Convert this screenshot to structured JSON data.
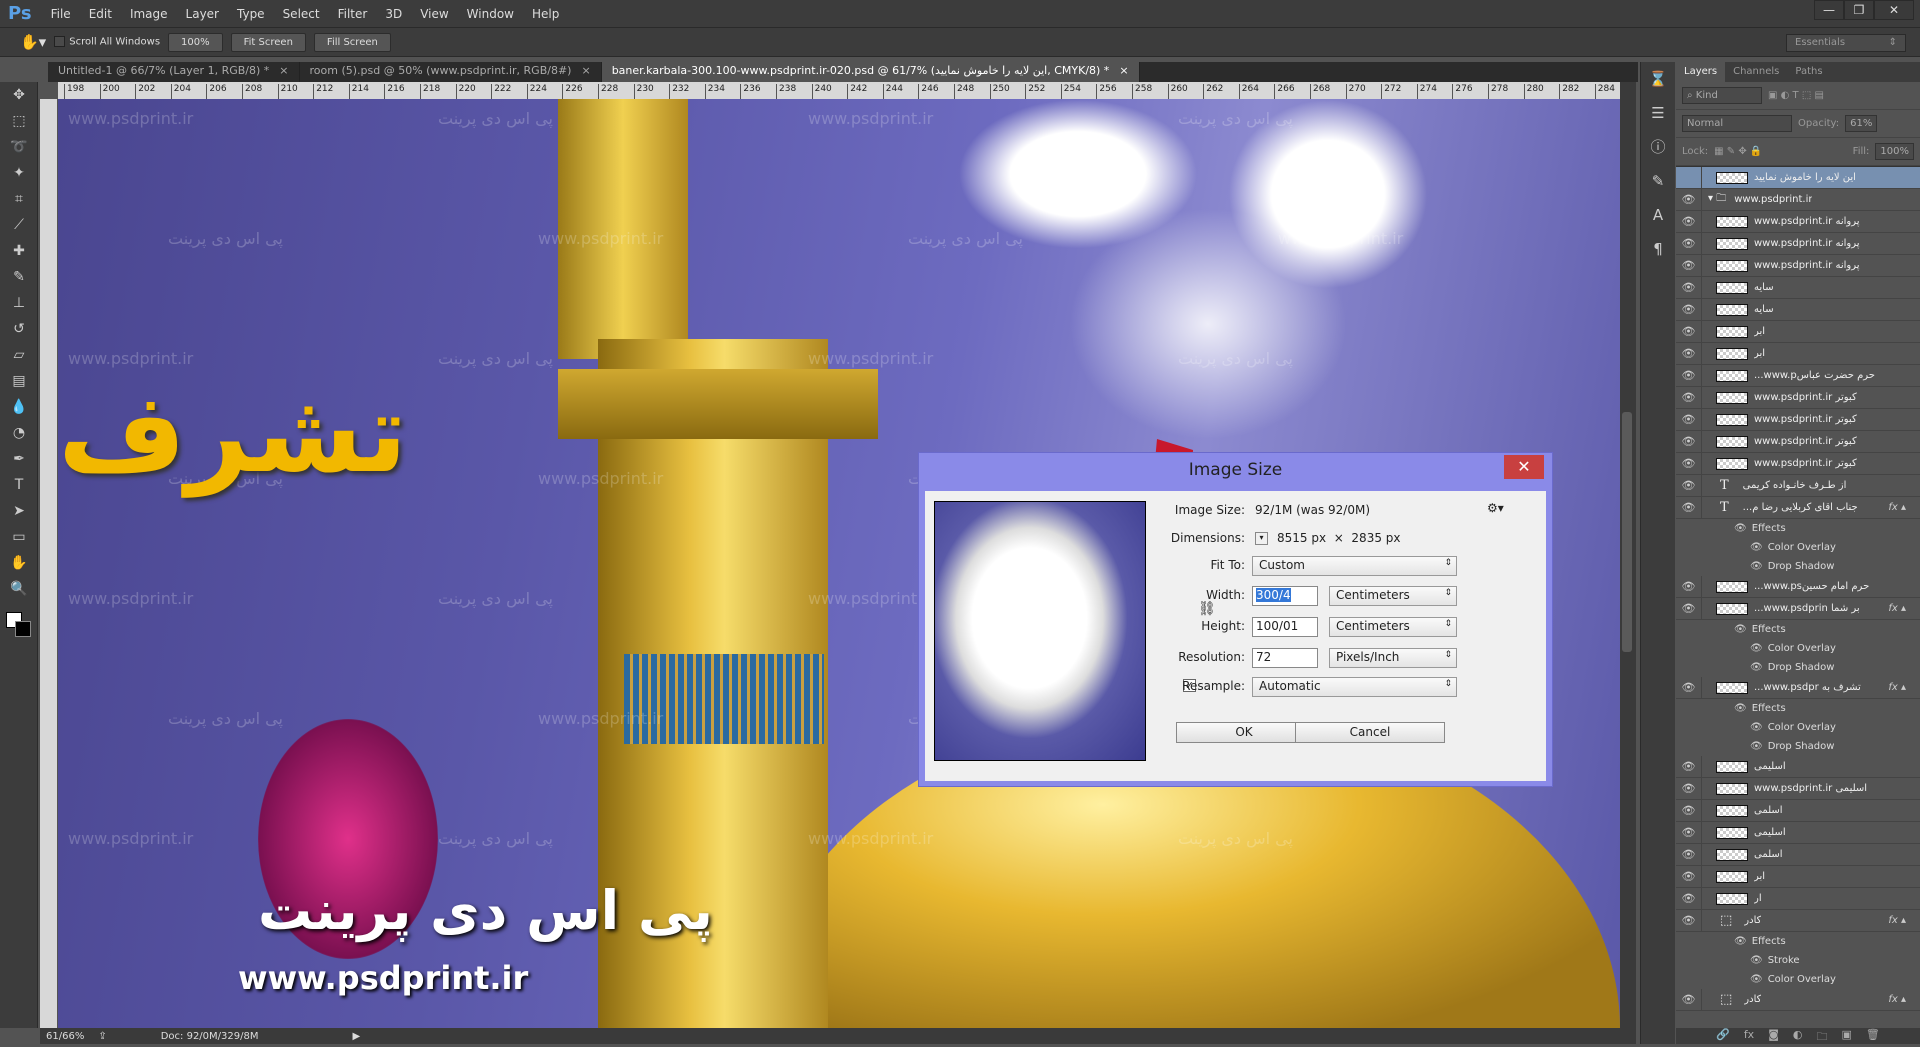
{
  "app": {
    "logo": "Ps",
    "menu": [
      "File",
      "Edit",
      "Image",
      "Layer",
      "Type",
      "Select",
      "Filter",
      "3D",
      "View",
      "Window",
      "Help"
    ],
    "window_controls": [
      "minimize",
      "restore",
      "close"
    ]
  },
  "options": {
    "scroll_all_windows": "Scroll All Windows",
    "zoom_100": "100%",
    "fit_screen": "Fit Screen",
    "fill_screen": "Fill Screen",
    "workspace": "Essentials"
  },
  "tabs": [
    {
      "label": "Untitled-1 @ 66/7% (Layer 1, RGB/8) *",
      "active": false
    },
    {
      "label": "room (5).psd @ 50% (www.psdprint.ir, RGB/8#)",
      "active": false
    },
    {
      "label": "baner.karbala-300.100-www.psdprint.ir-020.psd  @  61/7% (این لایه را خاموش نمایید, CMYK/8) *",
      "active": true
    }
  ],
  "ruler_ticks": [
    "198",
    "200",
    "202",
    "204",
    "206",
    "208",
    "210",
    "212",
    "214",
    "216",
    "218",
    "220",
    "222",
    "224",
    "226",
    "228",
    "230",
    "232",
    "234",
    "236",
    "238",
    "240",
    "242",
    "244",
    "246",
    "248",
    "250",
    "252",
    "254",
    "256",
    "258",
    "260",
    "262",
    "264",
    "266",
    "268",
    "270",
    "272",
    "274",
    "276",
    "278",
    "280",
    "282",
    "284"
  ],
  "tools": [
    "move-icon",
    "marquee-icon",
    "lasso-icon",
    "magic-wand-icon",
    "crop-icon",
    "eyedropper-icon",
    "healing-brush-icon",
    "brush-icon",
    "clone-stamp-icon",
    "history-brush-icon",
    "eraser-icon",
    "gradient-icon",
    "blur-icon",
    "dodge-icon",
    "pen-icon",
    "type-icon",
    "path-selection-icon",
    "rectangle-icon",
    "hand-icon",
    "zoom-icon"
  ],
  "canvas": {
    "watermark_latin": "www.psdprint.ir",
    "watermark_persian": "پی اس دی پرینت",
    "logo_url": "www.psdprint.ir",
    "calligraphy": "تشرف",
    "logo_persian": "پی اس دی پرینت"
  },
  "status": {
    "zoom": "61/66%",
    "doc": "Doc: 92/0M/329/8M"
  },
  "dialog": {
    "title": "Image Size",
    "close": "✕",
    "image_size_label": "Image Size:",
    "image_size_value": "92/1M (was 92/0M)",
    "dimensions_label": "Dimensions:",
    "dim_w": "8515 px",
    "dim_x": "×",
    "dim_h": "2835 px",
    "fit_to_label": "Fit To:",
    "fit_to_value": "Custom",
    "width_label": "Width:",
    "width_value": "300/4",
    "width_unit": "Centimeters",
    "height_label": "Height:",
    "height_value": "100/01",
    "height_unit": "Centimeters",
    "resolution_label": "Resolution:",
    "resolution_value": "72",
    "resolution_unit": "Pixels/Inch",
    "resample_label": "Resample:",
    "resample_checked": true,
    "resample_value": "Automatic",
    "ok": "OK",
    "cancel": "Cancel"
  },
  "layers_panel": {
    "tabs": [
      "Layers",
      "Channels",
      "Paths"
    ],
    "kind": "Kind",
    "blend": "Normal",
    "opacity_label": "Opacity:",
    "opacity": "61%",
    "lock_label": "Lock:",
    "fill_label": "Fill:",
    "fill": "100%",
    "layers": [
      {
        "name": "این لایه را خاموش نمایید",
        "selected": true,
        "visible": false
      },
      {
        "name": "www.psdprint.ir",
        "group": true,
        "visible": true
      },
      {
        "name": "www.psdprint.ir پروانه",
        "visible": true
      },
      {
        "name": "www.psdprint.ir پروانه",
        "visible": true
      },
      {
        "name": "www.psdprint.ir پروانه",
        "visible": true
      },
      {
        "name": "سایه",
        "visible": true
      },
      {
        "name": "سایه",
        "visible": true
      },
      {
        "name": "ابر",
        "visible": true
      },
      {
        "name": "ابر",
        "visible": true
      },
      {
        "name": "...www.pحرم حضرت عباس",
        "visible": true
      },
      {
        "name": "www.psdprint.ir کبوتر",
        "visible": true
      },
      {
        "name": "www.psdprint.ir کبوتر",
        "visible": true
      },
      {
        "name": "www.psdprint.ir کبوتر",
        "visible": true
      },
      {
        "name": "www.psdprint.ir کبوتر",
        "visible": true
      },
      {
        "name": "از طـرف خانـواده کریمی",
        "type": "text",
        "visible": true
      },
      {
        "name": "...جناب آقای کربلایی رضا م",
        "type": "text",
        "fx": true,
        "effects": [
          "Effects",
          "Color Overlay",
          "Drop Shadow"
        ],
        "visible": true
      },
      {
        "name": "...www.psحرم امام حسین",
        "visible": true
      },
      {
        "name": "...www.psdprin بر شما",
        "fx": true,
        "effects": [
          "Effects",
          "Color Overlay",
          "Drop Shadow"
        ],
        "visible": true
      },
      {
        "name": "...www.psdpr تشرف به",
        "fx": true,
        "effects": [
          "Effects",
          "Color Overlay",
          "Drop Shadow"
        ],
        "visible": true
      },
      {
        "name": "اسلیمی",
        "visible": true
      },
      {
        "name": "www.psdprint.ir اسلیمی",
        "visible": true
      },
      {
        "name": "اسلمی",
        "visible": true
      },
      {
        "name": "اسلیمی",
        "visible": true
      },
      {
        "name": "اسلمی",
        "visible": true
      },
      {
        "name": "ابر",
        "visible": true
      },
      {
        "name": "ار",
        "visible": true
      },
      {
        "name": "کادر",
        "type": "shape",
        "fx": true,
        "effects": [
          "Effects",
          "Stroke",
          "Color Overlay"
        ],
        "visible": true
      },
      {
        "name": "کادر",
        "type": "shape",
        "fx": true,
        "visible": true
      }
    ],
    "footer": [
      "link-icon",
      "fx-icon",
      "mask-icon",
      "adjustment-icon",
      "folder-icon",
      "new-layer-icon",
      "trash-icon"
    ]
  }
}
